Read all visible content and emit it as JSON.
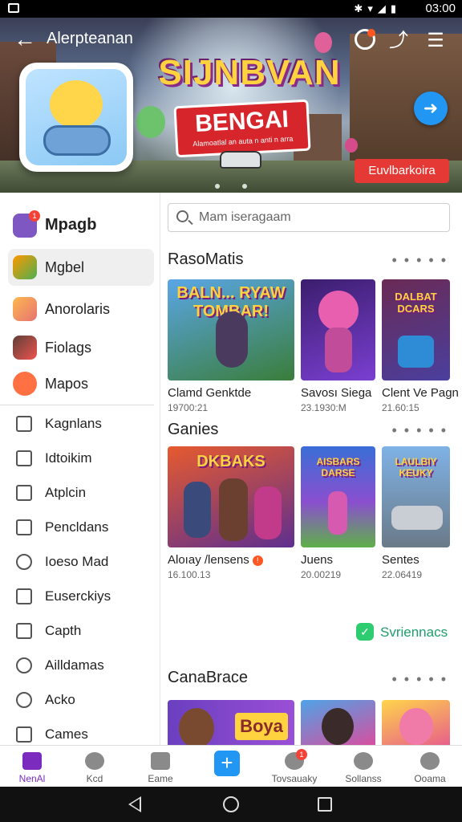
{
  "status_bar": {
    "time": "03:00"
  },
  "header": {
    "title": "Alerpteanan",
    "game_title": "SIJNBVAN",
    "game_plate": "BENGAI",
    "game_plate_sub": "Alamoatlal an auta n anti n arra",
    "cta": "Euvlbarkoira",
    "colors": {
      "cta": "#e53935",
      "fab": "#2196f3"
    }
  },
  "sidebar": {
    "apps": [
      {
        "label": "Mpagb",
        "badge": "1"
      },
      {
        "label": "Mgbel"
      },
      {
        "label": "Anorolaris"
      },
      {
        "label": "Fiolags"
      },
      {
        "label": "Mapos"
      }
    ],
    "items": [
      {
        "label": "Kagnlans",
        "icon": "list-icon"
      },
      {
        "label": "Idtoikim",
        "icon": "edit-icon"
      },
      {
        "label": "Atplcin",
        "icon": "minus-box-icon"
      },
      {
        "label": "Pencldans",
        "icon": "settings-box-icon"
      },
      {
        "label": "Ioeso Mad",
        "icon": "gear-icon"
      },
      {
        "label": "Euserckiys",
        "icon": "history-icon"
      },
      {
        "label": "Capth",
        "icon": "frame-icon"
      },
      {
        "label": "Ailldamas",
        "icon": "bell-icon"
      },
      {
        "label": "Acko",
        "icon": "search-icon"
      },
      {
        "label": "Cames",
        "icon": "play-icon"
      }
    ]
  },
  "search": {
    "placeholder": "Mam iseragaam"
  },
  "sections": [
    {
      "title": "RasoMatis",
      "more": "• • • • •",
      "cards": [
        {
          "name": "Clamd Genktde",
          "meta": "19700:21",
          "art": "BALN... RYAW TOMBAR!"
        },
        {
          "name": "Savosı Siega",
          "meta": "23.1930:M"
        },
        {
          "name": "Clent Ve Pagn",
          "meta": "21.60:15",
          "art": "DALBAT DCARS"
        }
      ]
    },
    {
      "title": "Ganies",
      "more": "• • • • •",
      "cards": [
        {
          "name": "Aloıay /lensens",
          "meta": "16.100.13",
          "badge": "!",
          "art": "DKBAKS"
        },
        {
          "name": "Juens",
          "meta": "20.00219",
          "art": "AISBARS DARSE"
        },
        {
          "name": "Sentes",
          "meta": "22.06419",
          "art": "LAULBIY KEUKY"
        }
      ]
    },
    {
      "title": "CanaBrace",
      "more": "• • • • •",
      "cards": [
        {
          "art": "Boya"
        }
      ]
    }
  ],
  "services_link": "Svriennacs",
  "bottom_nav": [
    {
      "label": "NenAl",
      "active": true
    },
    {
      "label": "Kcd"
    },
    {
      "label": "Eame"
    },
    {
      "label": "+",
      "is_add": true
    },
    {
      "label": "Tovsauaky",
      "badge": "1"
    },
    {
      "label": "Sollanss"
    },
    {
      "label": "Ooama"
    }
  ]
}
